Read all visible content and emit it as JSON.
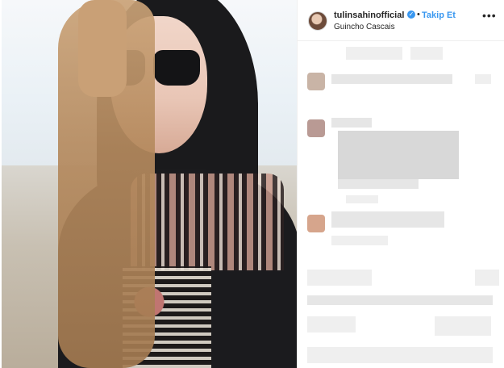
{
  "post": {
    "username": "tulinsahinofficial",
    "verified_icon": "verified-badge-icon",
    "separator": "•",
    "follow_label": "Takip Et",
    "location": "Guincho Cascais",
    "more_icon": "ellipsis-icon",
    "more_label": "•••",
    "accent_color": "#3897f0"
  }
}
